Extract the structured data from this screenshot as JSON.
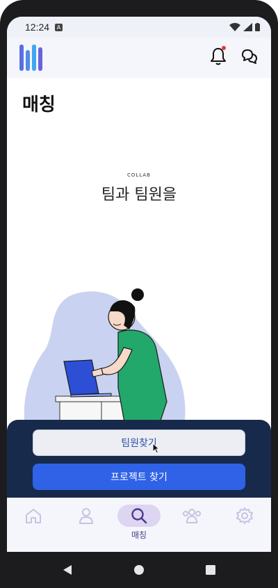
{
  "status_bar": {
    "time": "12:24",
    "notification_badge": "A"
  },
  "header": {
    "logo_icon": "app-logo-bars",
    "notification_icon": "bell-icon",
    "chat_icon": "chat-bubbles-icon",
    "unread_dot_color": "#e53935"
  },
  "main": {
    "page_title": "매칭",
    "eyebrow": "COLLAB",
    "headline": "팀과 팀원을"
  },
  "actions": {
    "primary_label": "팀원찾기",
    "secondary_label": "프로젝트 찾기"
  },
  "bottom_nav": {
    "items": [
      {
        "icon": "home-icon",
        "label": ""
      },
      {
        "icon": "person-icon",
        "label": ""
      },
      {
        "icon": "search-icon",
        "label": "매칭",
        "active": true
      },
      {
        "icon": "people-icon",
        "label": ""
      },
      {
        "icon": "gear-icon",
        "label": ""
      }
    ]
  },
  "colors": {
    "accent": "#2f62e6",
    "sheet_bg": "#172a4c",
    "nav_active_pill": "#ddd5f2"
  }
}
